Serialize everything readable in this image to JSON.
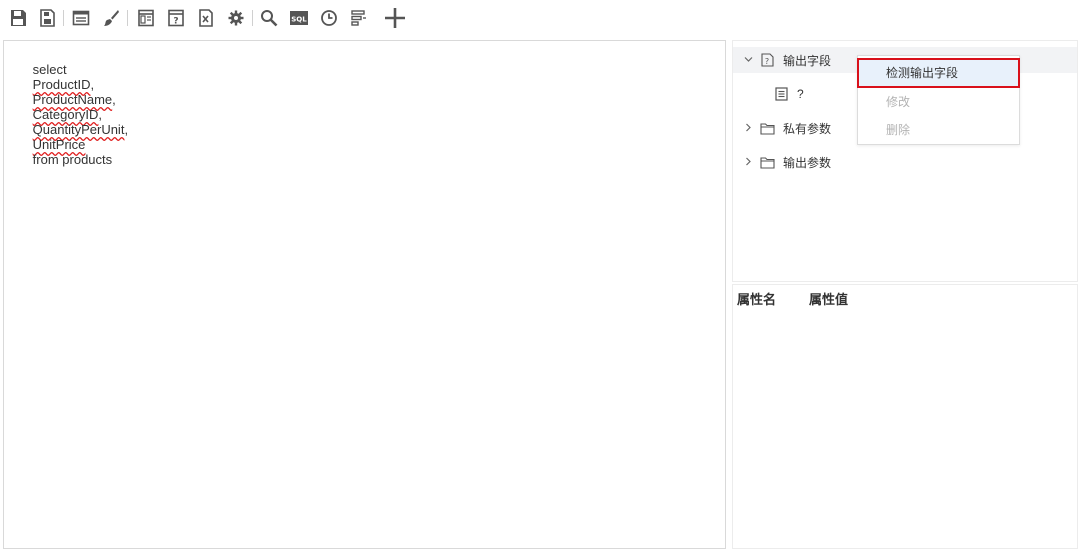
{
  "toolbar": {
    "icons": [
      "save-icon",
      "save-as-icon",
      "table-icon",
      "brush-icon",
      "form-icon",
      "param-form-icon",
      "excel-export-icon",
      "settings-gear-icon",
      "search-icon",
      "sql-icon",
      "clock-icon",
      "filter-icon",
      "add-icon"
    ]
  },
  "editor": {
    "sql": {
      "keyword_select": "select",
      "fields": [
        "ProductID",
        "ProductName",
        "CategoryID",
        "QuantityPerUnit",
        "UnitPrice"
      ],
      "sep": ",",
      "tail": "from products"
    }
  },
  "tree": {
    "output_fields": "输出字段",
    "field_item": "?",
    "private_params": "私有参数",
    "output_params": "输出参数"
  },
  "context_menu": {
    "detect": "检测输出字段",
    "edit": "修改",
    "delete": "删除"
  },
  "properties": {
    "col_name": "属性名",
    "col_value": "属性值"
  },
  "colors": {
    "highlight_border": "#d9101a",
    "menu_active_bg": "#e8f1fb",
    "squiggle": "#e02020"
  }
}
